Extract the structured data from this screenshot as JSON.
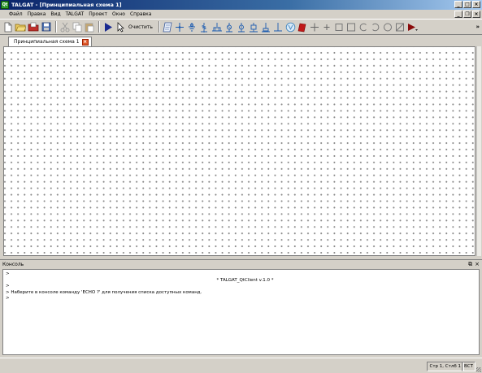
{
  "window": {
    "title": "TALGAT - [Принципиальная схема 1]",
    "app_icon": "Qt"
  },
  "menu": [
    "Файл",
    "Правка",
    "Вид",
    "TALGAT",
    "Проект",
    "Окно",
    "Справка"
  ],
  "toolbar": {
    "clear_label": "Очистить",
    "icons": [
      "new-file-icon",
      "open-folder-icon",
      "open-project-icon",
      "save-icon",
      "cut-icon",
      "copy-icon",
      "paste-icon",
      "run-icon",
      "select-arrow-icon"
    ],
    "component_icons": [
      "script-icon",
      "node-icon",
      "ground-icon",
      "resistor-icon",
      "capacitor-icon",
      "inductor-icon",
      "voltage-source-icon",
      "current-source-icon",
      "line-icon",
      "ground-bar-icon",
      "voltmeter-icon",
      "eraser-icon",
      "cross-icon",
      "plus-icon",
      "square-icon",
      "square-outline-icon",
      "rotate-left-icon",
      "rotate-right-icon",
      "circle-icon",
      "diagonal-icon",
      "play-marker-icon"
    ],
    "more": "»"
  },
  "tab": {
    "label": "Принципиальная схема 1"
  },
  "console": {
    "title": "Консоль",
    "lines": [
      ">",
      "* TALGAT_QtClient v.1.0 *",
      ">",
      "> Наберите в консоле команду 'ECHO ?' для получения списка доступных команд.",
      ">"
    ]
  },
  "status": {
    "position": "Стр 1, Стлб 1",
    "mode": "ВСТ"
  },
  "colors": {
    "accent": "#0a246a",
    "tab_close": "#e05a2a",
    "grid_dot": "#8a8a8a"
  }
}
